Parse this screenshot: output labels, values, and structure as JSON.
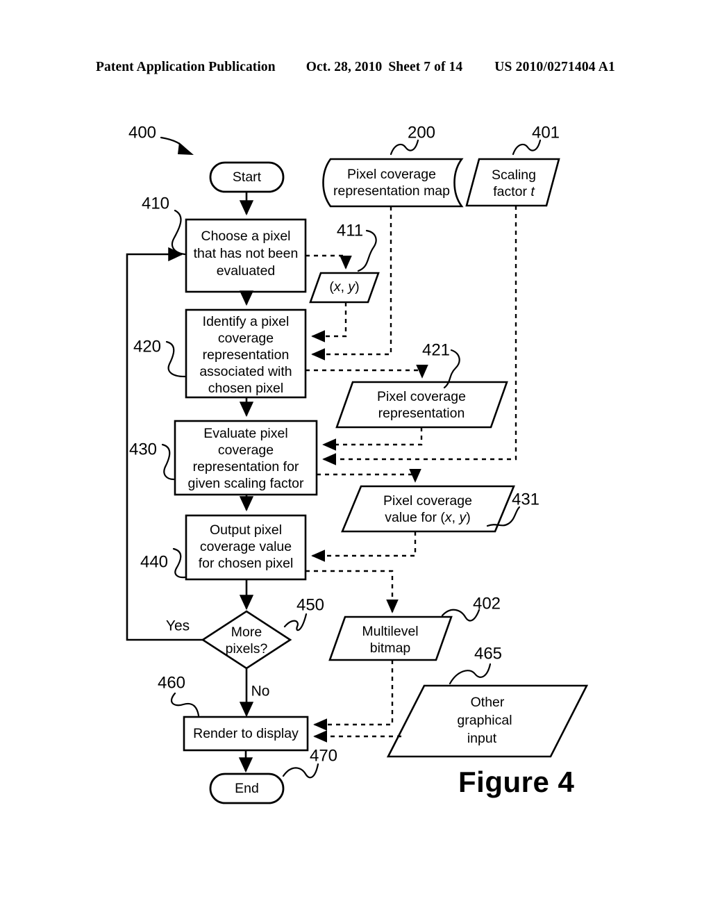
{
  "header": {
    "publication": "Patent Application Publication",
    "date": "Oct. 28, 2010",
    "sheet": "Sheet 7 of 14",
    "patent_number": "US 2010/0271404 A1"
  },
  "figure": {
    "caption": "Figure 4",
    "diagram_ref": "400"
  },
  "nodes": {
    "start": {
      "label": "Start",
      "shape": "terminator"
    },
    "end": {
      "label": "End",
      "shape": "terminator"
    },
    "choose_pixel": {
      "ref": "410",
      "shape": "process",
      "lines": [
        "Choose a pixel",
        "that has not been",
        "evaluated"
      ]
    },
    "identify_representation": {
      "ref": "420",
      "shape": "process",
      "lines": [
        "Identify a pixel",
        "coverage",
        "representation",
        "associated with",
        "chosen pixel"
      ]
    },
    "evaluate_representation": {
      "ref": "430",
      "shape": "process",
      "lines": [
        "Evaluate pixel",
        "coverage",
        "representation for",
        "given scaling factor"
      ]
    },
    "output_value": {
      "ref": "440",
      "shape": "process",
      "lines": [
        "Output pixel",
        "coverage value",
        "for chosen pixel"
      ]
    },
    "more_pixels": {
      "ref": "450",
      "shape": "decision",
      "lines": [
        "More",
        "pixels?"
      ],
      "branch_yes": "Yes",
      "branch_no": "No"
    },
    "render_to_display": {
      "ref": "460",
      "shape": "process",
      "lines": [
        "Render to display"
      ]
    },
    "end_ref": "470",
    "coverage_map": {
      "ref": "200",
      "shape": "stored-data",
      "lines": [
        "Pixel coverage",
        "representation map"
      ]
    },
    "scaling_factor": {
      "ref": "401",
      "shape": "data",
      "lines": [
        "Scaling",
        "factor t"
      ],
      "italic_tail": "t"
    },
    "xy_data": {
      "ref": "411",
      "shape": "data",
      "lines": [
        "(x, y)"
      ]
    },
    "coverage_representation": {
      "ref": "421",
      "shape": "data",
      "lines": [
        "Pixel coverage",
        "representation"
      ]
    },
    "coverage_value": {
      "ref": "431",
      "shape": "data",
      "lines": [
        "Pixel coverage",
        "value for (x, y)"
      ]
    },
    "multilevel_bitmap": {
      "ref": "402",
      "shape": "data",
      "lines": [
        "Multilevel",
        "bitmap"
      ]
    },
    "other_graphical_input": {
      "ref": "465",
      "shape": "data",
      "lines": [
        "Other",
        "graphical",
        "input"
      ]
    }
  },
  "colors": {
    "ink": "#000000",
    "paper": "#ffffff"
  }
}
